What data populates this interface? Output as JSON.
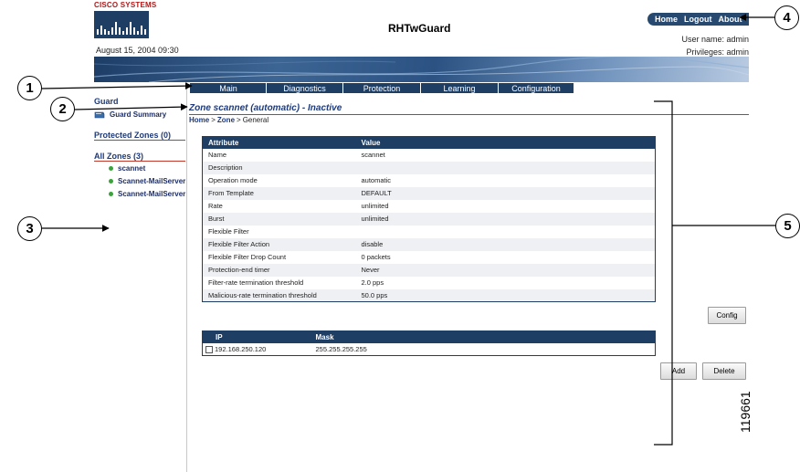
{
  "header": {
    "brand": "CISCO SYSTEMS",
    "date": "August 15, 2004 09:30",
    "app_title": "RHTwGuard",
    "links": [
      "Home",
      "Logout",
      "About"
    ],
    "user_name": "User name: admin",
    "privileges": "Privileges: admin"
  },
  "tabs": [
    "Main",
    "Diagnostics",
    "Protection",
    "Learning",
    "Configuration"
  ],
  "sidebar": {
    "guard_label": "Guard",
    "guard_summary": "Guard Summary",
    "protected_zones": "Protected Zones (0)",
    "all_zones": "All Zones (3)",
    "zones": [
      "scannet",
      "Scannet-MailServer",
      "Scannet-MailServer"
    ]
  },
  "content": {
    "zone_title": "Zone scannet (automatic) - Inactive",
    "breadcrumb": [
      "Home",
      ">",
      "Zone",
      ">",
      "General"
    ],
    "attr_table": {
      "headers": [
        "Attribute",
        "Value"
      ],
      "rows": [
        [
          "Name",
          "scannet"
        ],
        [
          "Description",
          ""
        ],
        [
          "Operation mode",
          "automatic"
        ],
        [
          "From Template",
          "DEFAULT"
        ],
        [
          "Rate",
          "unlimited"
        ],
        [
          "Burst",
          "unlimited"
        ],
        [
          "Flexible Filter",
          ""
        ],
        [
          "Flexible Filter Action",
          "disable"
        ],
        [
          "Flexible Filter Drop Count",
          "0 packets"
        ],
        [
          "Protection-end timer",
          "Never"
        ],
        [
          "Filter-rate termination threshold",
          "2.0 pps"
        ],
        [
          "Malicious-rate termination threshold",
          "50.0 pps"
        ]
      ]
    },
    "config_button": "Config",
    "ip_table": {
      "headers": [
        "IP",
        "Mask"
      ],
      "rows": [
        [
          "192.168.250.120",
          "255.255.255.255"
        ]
      ]
    },
    "add_button": "Add",
    "delete_button": "Delete"
  },
  "callouts": [
    "1",
    "2",
    "3",
    "4",
    "5"
  ],
  "figure_id": "119661",
  "colors": {
    "navy": "#1f3e64",
    "link_blue": "#1e3a7a",
    "rule_red": "#c0392b",
    "status_green": "#3aa33a"
  }
}
